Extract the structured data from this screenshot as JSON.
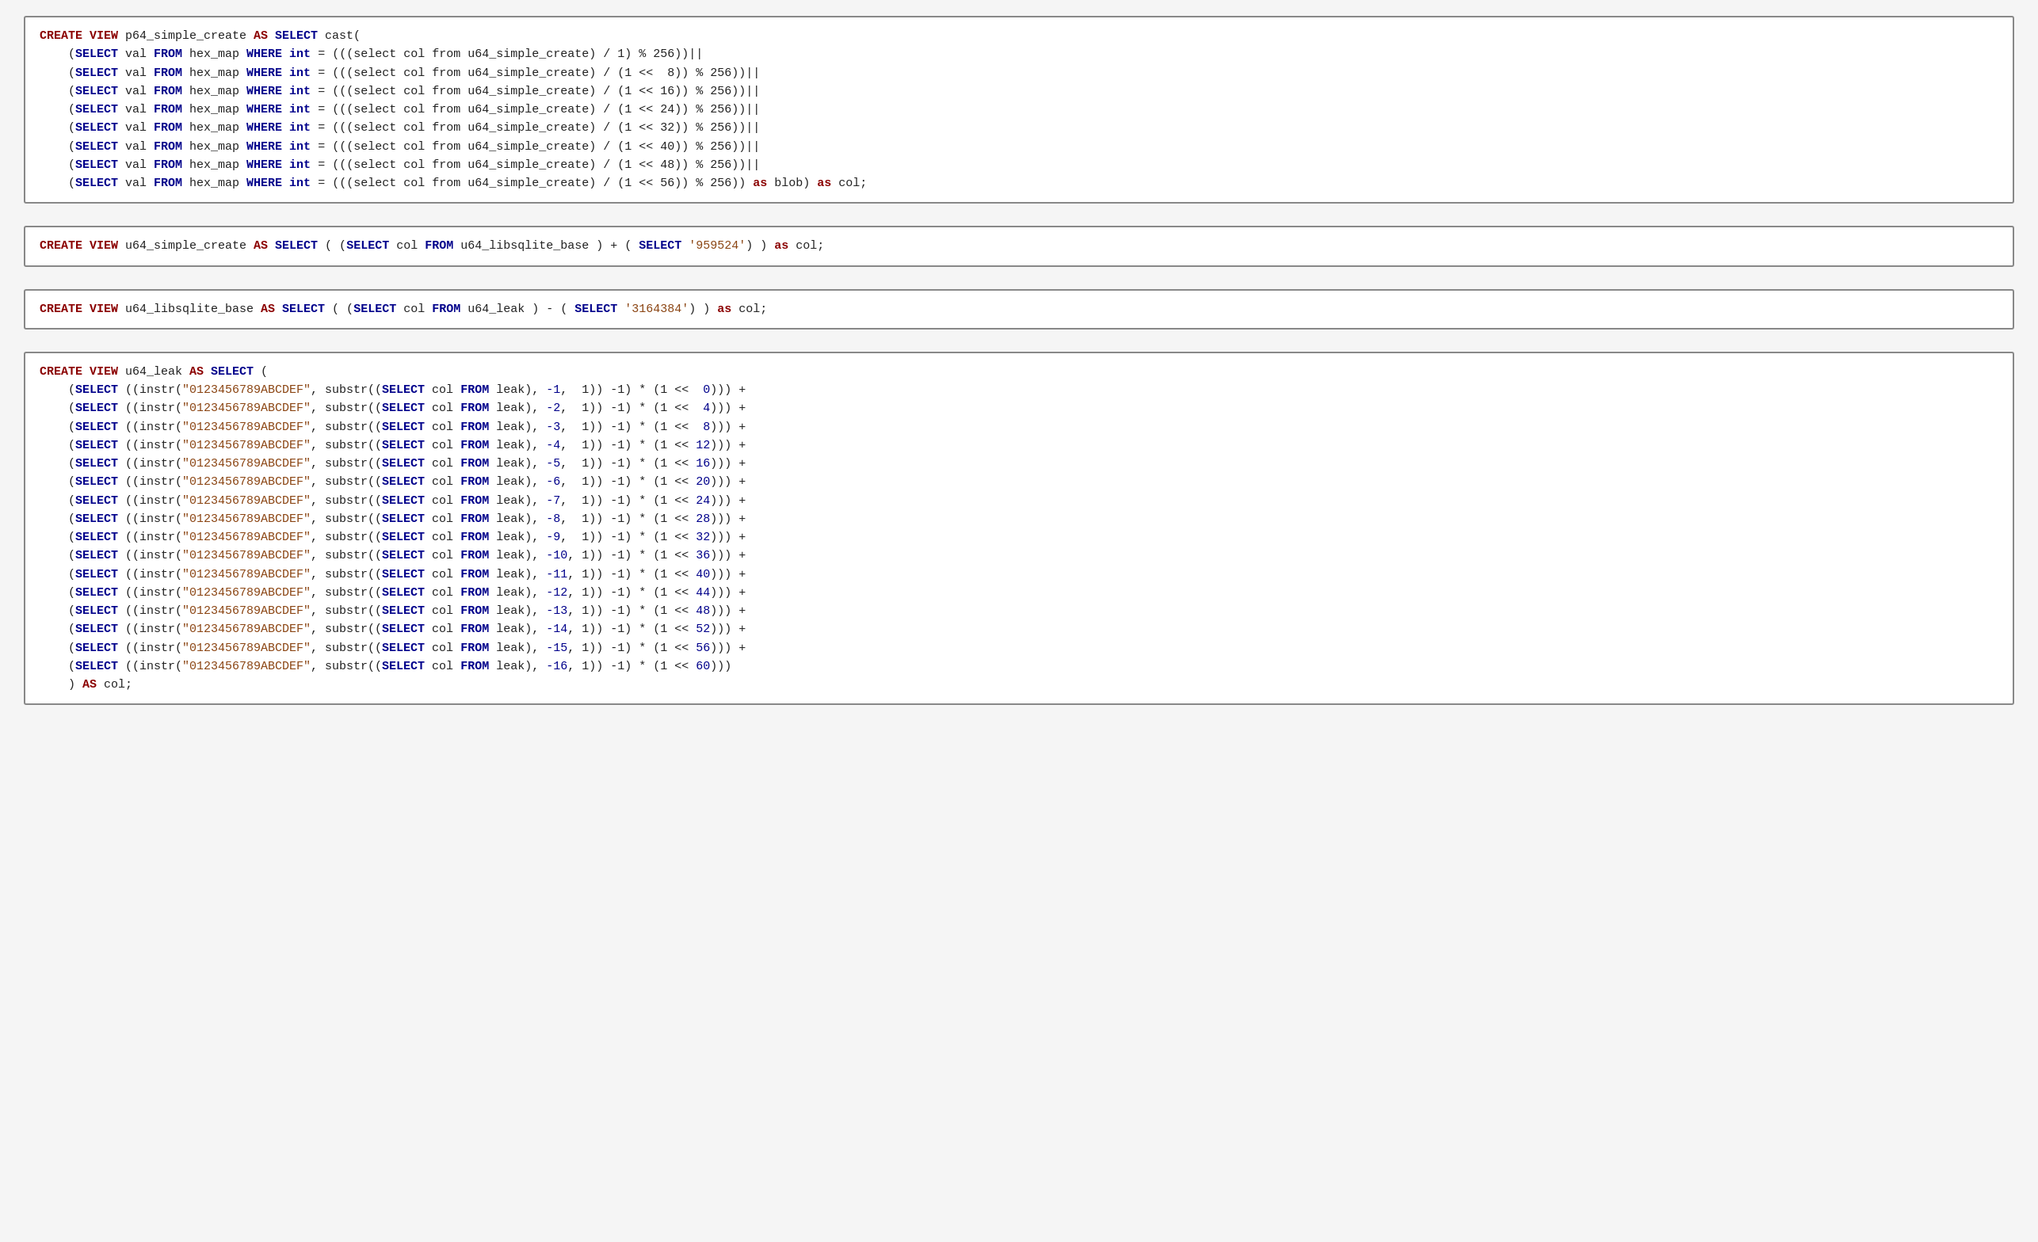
{
  "blocks": [
    {
      "id": "block1",
      "label": "p64_simple_create view"
    },
    {
      "id": "block2",
      "label": "u64_simple_create view"
    },
    {
      "id": "block3",
      "label": "u64_libsqlite_base view"
    },
    {
      "id": "block4",
      "label": "u64_leak view"
    }
  ]
}
